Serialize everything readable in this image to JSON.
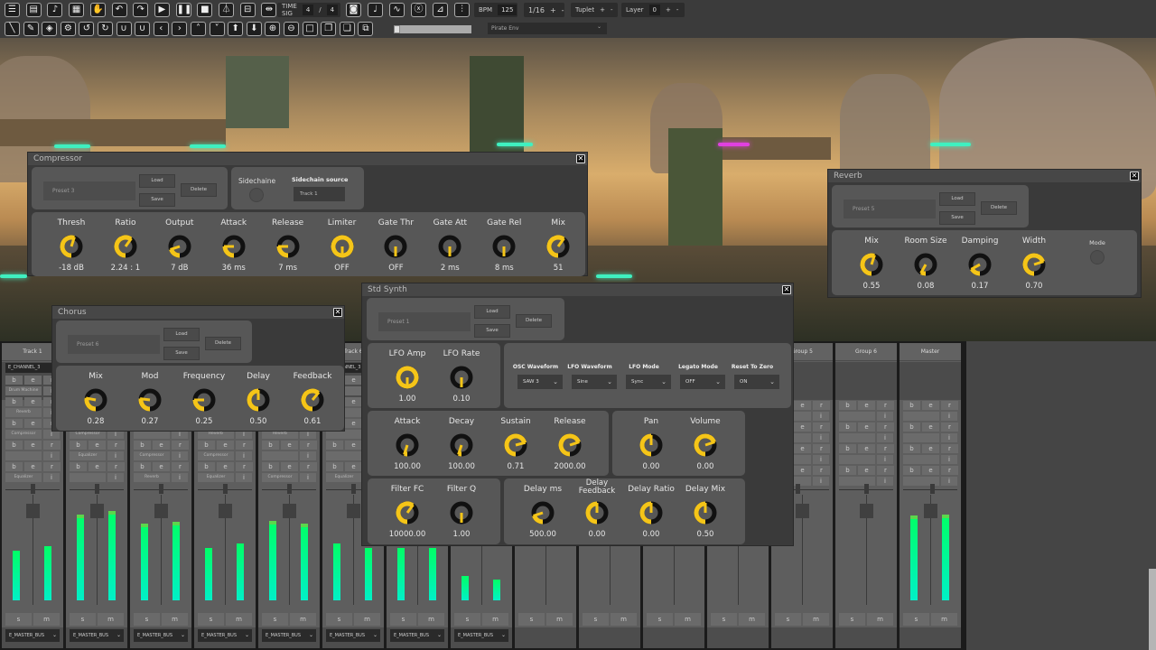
{
  "toolbar": {
    "row1_icons": [
      "list-icon",
      "save-icon",
      "export-midi-icon",
      "grid-icon",
      "hand-icon",
      "undo-icon",
      "redo-icon",
      "play-icon",
      "pause-icon",
      "stop-icon",
      "metronome-icon",
      "collapse-icon",
      "expand-icon"
    ],
    "time_sig": {
      "label": "TIME SIG",
      "num": "4",
      "sep": "/",
      "den": "4"
    },
    "row1_icons_b": [
      "camera-icon",
      "note-icon",
      "curve-icon",
      "function-icon",
      "piano-icon",
      "mixer-icon"
    ],
    "bpm": {
      "label": "BPM",
      "value": "125"
    },
    "grid": {
      "value": "1/16",
      "plus": "+",
      "minus": "-"
    },
    "tuplet": {
      "label": "Tuplet",
      "plus": "+",
      "minus": "-"
    },
    "layer": {
      "label": "Layer",
      "value": "0",
      "plus": "+",
      "minus": "-"
    },
    "row2_icons": [
      "line-icon",
      "pencil-icon",
      "eraser-icon",
      "gear-icon",
      "rotate-ccw-icon",
      "rotate-cw-icon",
      "loop-left-icon",
      "loop-right-icon",
      "chevron-left-icon",
      "chevron-right-icon",
      "chevron-up-icon",
      "chevron-down-icon",
      "arrow-up-icon",
      "arrow-down-icon",
      "zoom-in-icon",
      "zoom-out-icon",
      "square-icon",
      "copy-icon",
      "paste-icon",
      "duplicate-icon"
    ],
    "progress": 0.08,
    "env_select": {
      "value": "Pirate Env",
      "chevron": "⌄"
    }
  },
  "preset_buttons": {
    "load": "Load",
    "save": "Save",
    "delete": "Delete"
  },
  "close_glyph": "✕",
  "accent_color": "#f5c518",
  "compressor": {
    "title": "Compressor",
    "preset": "Preset 3",
    "sidechain_label": "Sidechaine",
    "sidechain_source_label": "Sidechain source",
    "sidechain_source": "Track 1",
    "knobs": [
      {
        "label": "Thresh",
        "value": "-18 dB",
        "level": 0.55
      },
      {
        "label": "Ratio",
        "value": "2.24 : 1",
        "level": 0.6
      },
      {
        "label": "Output",
        "value": "7 dB",
        "level": 0.2
      },
      {
        "label": "Attack",
        "value": "36 ms",
        "level": 0.25
      },
      {
        "label": "Release",
        "value": "7 ms",
        "level": 0.25
      },
      {
        "label": "Limiter",
        "value": "OFF",
        "level": 1.0
      },
      {
        "label": "Gate Thr",
        "value": "OFF",
        "level": 0
      },
      {
        "label": "Gate Att",
        "value": "2 ms",
        "level": 0
      },
      {
        "label": "Gate Rel",
        "value": "8 ms",
        "level": 0
      },
      {
        "label": "Mix",
        "value": "51",
        "level": 0.6
      }
    ]
  },
  "chorus": {
    "title": "Chorus",
    "preset": "Preset 6",
    "knobs": [
      {
        "label": "Mix",
        "value": "0.28",
        "level": 0.28
      },
      {
        "label": "Mod",
        "value": "0.27",
        "level": 0.27
      },
      {
        "label": "Frequency",
        "value": "0.25",
        "level": 0.25
      },
      {
        "label": "Delay",
        "value": "0.50",
        "level": 0.5
      },
      {
        "label": "Feedback",
        "value": "0.61",
        "level": 0.61
      }
    ]
  },
  "reverb": {
    "title": "Reverb",
    "preset": "Preset 5",
    "mode_label": "Mode",
    "knobs": [
      {
        "label": "Mix",
        "value": "0.55",
        "level": 0.55
      },
      {
        "label": "Room Size",
        "value": "0.08",
        "level": 0.08
      },
      {
        "label": "Damping",
        "value": "0.17",
        "level": 0.17
      },
      {
        "label": "Width",
        "value": "0.70",
        "level": 0.7
      }
    ]
  },
  "synth": {
    "title": "Std Synth",
    "preset": "Preset 1",
    "lfo": [
      {
        "label": "LFO Amp",
        "value": "1.00",
        "level": 1.0
      },
      {
        "label": "LFO Rate",
        "value": "0.10",
        "level": 0
      }
    ],
    "dropdowns": [
      {
        "label": "OSC Waveform",
        "value": "SAW 3"
      },
      {
        "label": "LFO Waveform",
        "value": "Sine"
      },
      {
        "label": "LFO Mode",
        "value": "Sync"
      },
      {
        "label": "Legato Mode",
        "value": "OFF"
      },
      {
        "label": "Reset To Zero",
        "value": "ON"
      }
    ],
    "adsr": [
      {
        "label": "Attack",
        "value": "100.00",
        "level": 0.05
      },
      {
        "label": "Decay",
        "value": "100.00",
        "level": 0.05
      },
      {
        "label": "Sustain",
        "value": "0.71",
        "level": 0.71
      },
      {
        "label": "Release",
        "value": "2000.00",
        "level": 0.7
      }
    ],
    "panvol": [
      {
        "label": "Pan",
        "value": "0.00",
        "level": 0.5
      },
      {
        "label": "Volume",
        "value": "0.00",
        "level": 0.7
      }
    ],
    "filter": [
      {
        "label": "Filter FC",
        "value": "10000.00",
        "level": 0.6
      },
      {
        "label": "Filter Q",
        "value": "1.00",
        "level": 0
      }
    ],
    "delay": [
      {
        "label": "Delay ms",
        "value": "500.00",
        "level": 0.2
      },
      {
        "label": "Delay Feedback",
        "value": "0.00",
        "level": 0.5
      },
      {
        "label": "Delay Ratio",
        "value": "0.00",
        "level": 0.5
      },
      {
        "label": "Delay Mix",
        "value": "0.50",
        "level": 0.5
      }
    ]
  },
  "mixer": {
    "slot_buttons": {
      "b": "b",
      "e": "e",
      "r": "r",
      "i": "i"
    },
    "solo": "s",
    "mute": "m",
    "strips": [
      {
        "name": "Track 1",
        "channel": "E_CHANNEL_3",
        "slots": [
          "Drum Machine",
          "Reverb",
          "Compressor",
          "",
          "Equalizer"
        ],
        "meter": [
          0.47,
          0.51
        ],
        "bus": "E_MASTER_BUS"
      },
      {
        "name": "",
        "channel": "",
        "slots": [
          "",
          "",
          "Compressor",
          "Equalizer",
          ""
        ],
        "meter": [
          0.81,
          0.85
        ],
        "bus": "E_MASTER_BUS"
      },
      {
        "name": "",
        "channel": "",
        "slots": [
          "",
          "",
          "",
          "Compressor",
          "Reverb"
        ],
        "meter": [
          0.73,
          0.74
        ],
        "bus": "E_MASTER_BUS"
      },
      {
        "name": "",
        "channel": "",
        "slots": [
          "",
          "",
          "Reverb",
          "Compressor",
          "Equalizer"
        ],
        "meter": [
          0.5,
          0.54
        ],
        "bus": "E_MASTER_BUS"
      },
      {
        "name": "",
        "channel": "",
        "slots": [
          "",
          "",
          "Reverb",
          "",
          "Compressor"
        ],
        "meter": [
          0.75,
          0.73
        ],
        "bus": "E_MASTER_BUS"
      },
      {
        "name": "Track 6",
        "channel": "E_CHANNEL_3",
        "slots": [
          "",
          "",
          "",
          "",
          "Equalizer"
        ],
        "meter": [
          0.54,
          0.5
        ],
        "bus": "E_MASTER_BUS"
      },
      {
        "name": "",
        "channel": "",
        "slots": [
          "",
          "",
          "",
          "",
          ""
        ],
        "meter": [
          0.5,
          0.5
        ],
        "bus": "E_MASTER_BUS"
      },
      {
        "name": "",
        "channel": "",
        "slots": [
          "",
          "",
          "",
          "",
          ""
        ],
        "meter": [
          0.23,
          0.2
        ],
        "bus": "E_MASTER_BUS"
      },
      {
        "name": "",
        "group": true,
        "slots": [
          "",
          "",
          "",
          ""
        ],
        "meter": [
          0,
          0
        ]
      },
      {
        "name": "",
        "group": true,
        "slots": [
          "",
          "",
          "",
          ""
        ],
        "meter": [
          0,
          0
        ]
      },
      {
        "name": "",
        "group": true,
        "slots": [
          "",
          "",
          "",
          ""
        ],
        "meter": [
          0,
          0
        ]
      },
      {
        "name": "",
        "group": true,
        "slots": [
          "",
          "",
          "",
          ""
        ],
        "meter": [
          0,
          0
        ]
      },
      {
        "name": "Group 5",
        "group": true,
        "slots": [
          "",
          "",
          "",
          ""
        ],
        "meter": [
          0,
          0
        ]
      },
      {
        "name": "Group 6",
        "group": true,
        "slots": [
          "",
          "",
          "",
          ""
        ],
        "meter": [
          0,
          0
        ]
      },
      {
        "name": "Master",
        "group": true,
        "slots": [
          "",
          "",
          "",
          ""
        ],
        "meter": [
          0.8,
          0.81
        ]
      }
    ]
  }
}
